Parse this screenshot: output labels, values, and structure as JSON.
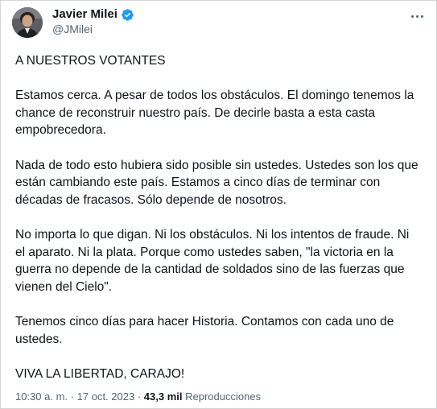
{
  "author": {
    "name": "Javier Milei",
    "handle": "@JMilei",
    "verified_color": "#1d9bf0"
  },
  "icons": {
    "avatar": "profile-photo",
    "verified": "verified-badge-icon",
    "more": "more-options-icon"
  },
  "tweet": {
    "paragraphs": [
      "A NUESTROS VOTANTES",
      "Estamos cerca. A pesar de todos los obstáculos. El domingo tenemos la chance de reconstruir nuestro país. De decirle basta a esta casta empobrecedora.",
      "Nada de todo esto hubiera sido posible sin ustedes. Ustedes son los que están cambiando este país. Estamos a cinco días de terminar con décadas de fracasos. Sólo depende de nosotros.",
      "No importa lo que digan. Ni los obstáculos. Ni los intentos de fraude. Ni el aparato. Ni la plata. Porque como ustedes saben, \"la victoria en la guerra no depende de la cantidad de soldados sino de las fuerzas que vienen del Cielo\".",
      "Tenemos cinco días para hacer Historia. Contamos con cada uno de ustedes.",
      "VIVA LA LIBERTAD, CARAJO!"
    ]
  },
  "meta": {
    "time": "10:30 a. m.",
    "separator": "·",
    "date": "17 oct. 2023",
    "views_count": "43,3 mil",
    "views_label": "Reproducciones"
  }
}
